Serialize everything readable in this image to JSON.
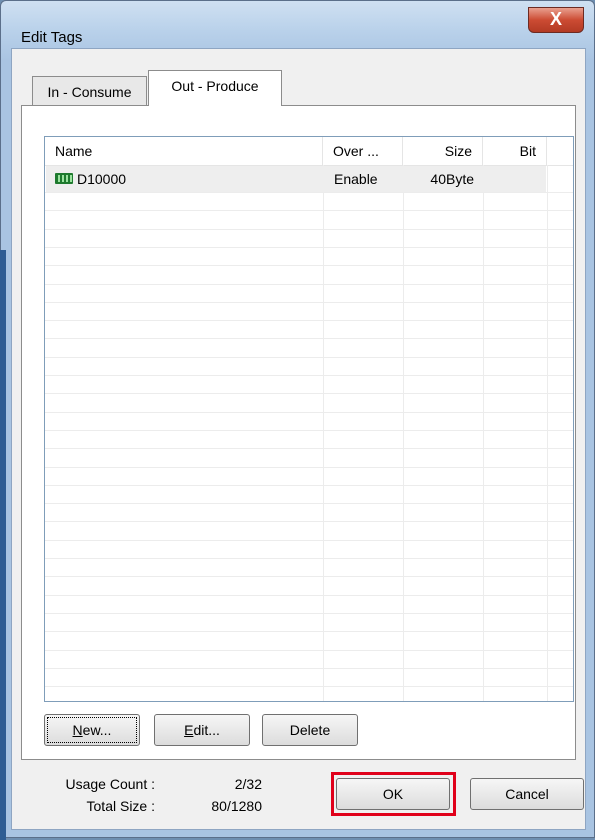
{
  "window": {
    "title": "Edit Tags",
    "close_label": "X"
  },
  "tabs": [
    {
      "label": "In - Consume",
      "active": false
    },
    {
      "label": "Out - Produce",
      "active": true
    }
  ],
  "table": {
    "columns": [
      "Name",
      "Over ...",
      "Size",
      "Bit"
    ],
    "rows": [
      {
        "name": "D10000",
        "over": "Enable",
        "size": "40Byte",
        "bit": "",
        "icon": "tag-icon"
      }
    ]
  },
  "buttons": {
    "new": "New...",
    "edit": "Edit...",
    "delete": "Delete",
    "ok": "OK",
    "cancel": "Cancel"
  },
  "stats": {
    "usage_label": "Usage Count :",
    "usage_value": "2/32",
    "total_label": "Total Size :",
    "total_value": "80/1280"
  },
  "colors": {
    "highlight": "#e0001a",
    "titlebar": "#b9d1ea",
    "close": "#cc4b33"
  }
}
